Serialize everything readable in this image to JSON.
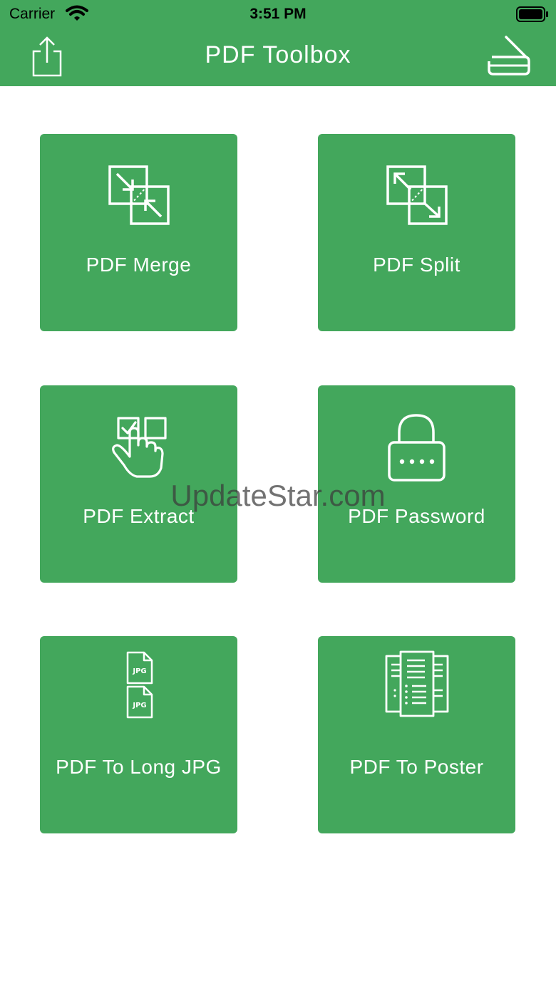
{
  "status_bar": {
    "carrier": "Carrier",
    "time": "3:51 PM"
  },
  "header": {
    "title": "PDF Toolbox",
    "left_icon": "share-icon",
    "right_icon": "scanner-icon"
  },
  "tools": [
    {
      "label": "PDF Merge",
      "icon": "merge-icon"
    },
    {
      "label": "PDF Split",
      "icon": "split-icon"
    },
    {
      "label": "PDF Extract",
      "icon": "extract-icon"
    },
    {
      "label": "PDF Password",
      "icon": "lock-icon"
    },
    {
      "label": "PDF To Long JPG",
      "icon": "jpg-files-icon",
      "icon_text": "JPG"
    },
    {
      "label": "PDF To Poster",
      "icon": "poster-icon"
    }
  ],
  "watermark": "UpdateStar.com",
  "colors": {
    "brand_green": "#43a75c",
    "icon_stroke": "#ffffff",
    "background": "#ffffff"
  }
}
